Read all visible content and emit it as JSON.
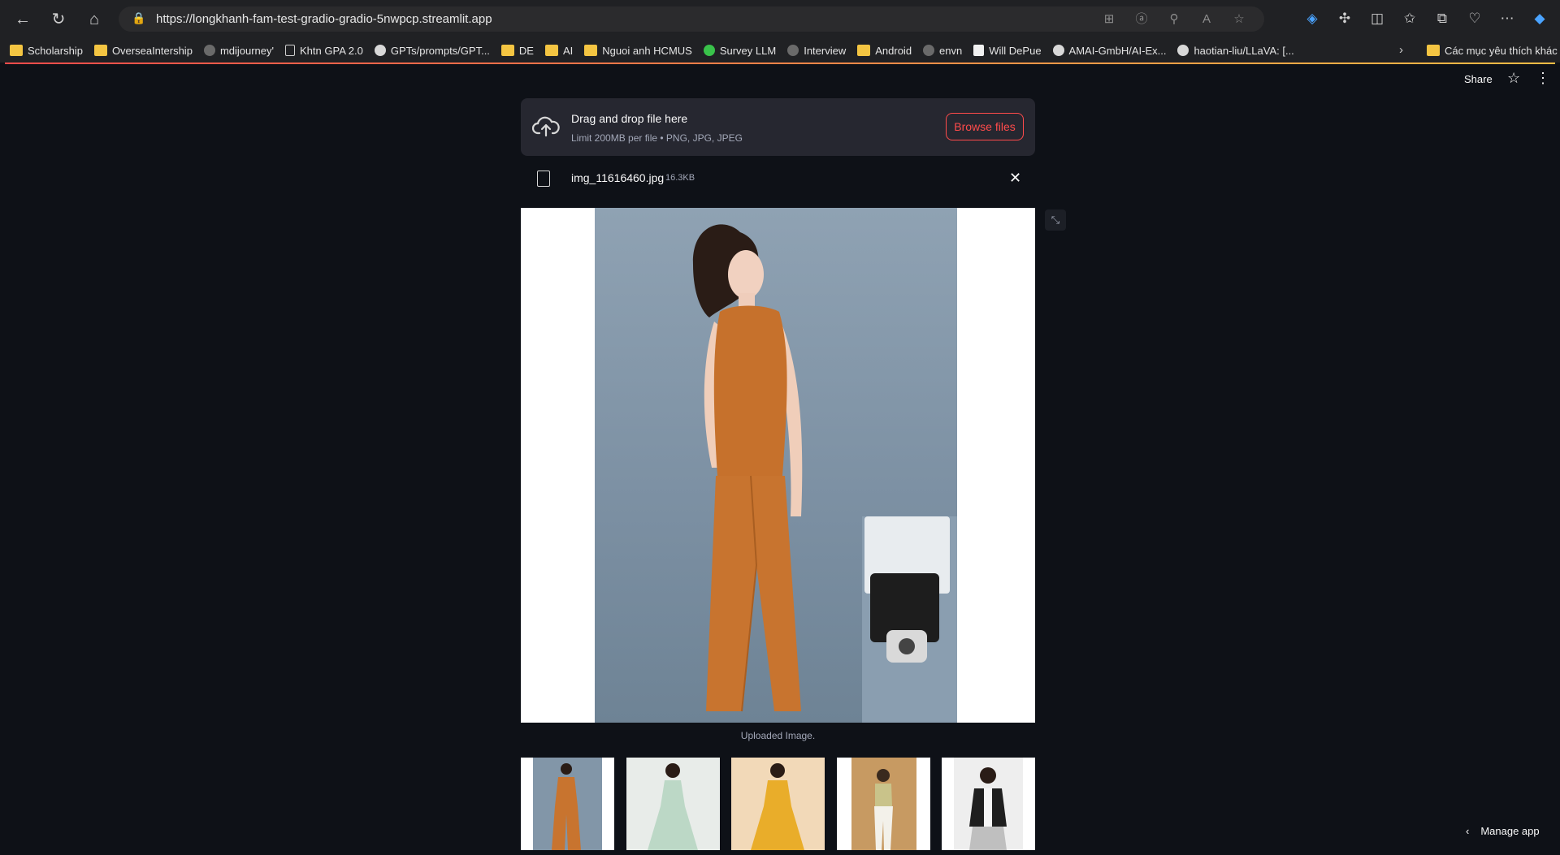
{
  "browser": {
    "url": "https://longkhanh-fam-test-gradio-gradio-5nwpcp.streamlit.app",
    "bookmarks": [
      {
        "label": "Scholarship",
        "icon": "folder"
      },
      {
        "label": "OverseaIntership",
        "icon": "folder"
      },
      {
        "label": "mdijourney'",
        "icon": "dark"
      },
      {
        "label": "Khtn GPA 2.0",
        "icon": "doc"
      },
      {
        "label": "GPTs/prompts/GPT...",
        "icon": "gh"
      },
      {
        "label": "DE",
        "icon": "folder"
      },
      {
        "label": "AI",
        "icon": "folder"
      },
      {
        "label": "Nguoi anh HCMUS",
        "icon": "folder"
      },
      {
        "label": "Survey LLM",
        "icon": "smile"
      },
      {
        "label": "Interview",
        "icon": "dark"
      },
      {
        "label": "Android",
        "icon": "folder"
      },
      {
        "label": "envn",
        "icon": "dark"
      },
      {
        "label": "Will DePue",
        "icon": "notion"
      },
      {
        "label": "AMAI-GmbH/AI-Ex...",
        "icon": "gh"
      },
      {
        "label": "haotian-liu/LLaVA: [...",
        "icon": "gh"
      }
    ],
    "bookmarks_other": "Các mục yêu thích khác"
  },
  "header": {
    "share": "Share"
  },
  "uploader": {
    "title": "Drag and drop file here",
    "subtitle": "Limit 200MB per file • PNG, JPG, JPEG",
    "browse_label": "Browse files"
  },
  "file": {
    "name": "img_11616460.jpg",
    "size": "16.3KB"
  },
  "image": {
    "caption": "Uploaded Image."
  },
  "footer": {
    "manage_app": "Manage app"
  },
  "thumbnails": [
    {
      "dress_color": "#c8742f",
      "bg": "#8296a8"
    },
    {
      "dress_color": "#bcd8c6",
      "bg": "#e8ece9"
    },
    {
      "dress_color": "#e9ad2a",
      "bg": "#f2d9b8"
    },
    {
      "dress_color": "#c9c38a",
      "bg": "#c79a62"
    },
    {
      "dress_color": "#1f1f1f",
      "bg": "#eeeeee"
    }
  ]
}
